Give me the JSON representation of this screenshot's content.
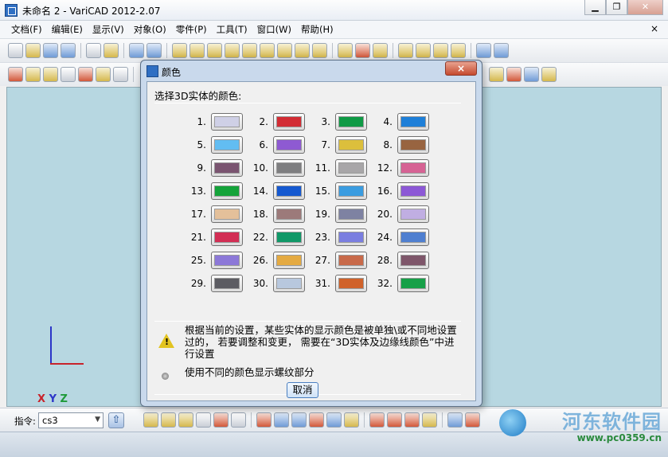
{
  "window": {
    "title": "未命名 2 - VariCAD 2012-2.07"
  },
  "menu": [
    "文档(F)",
    "编辑(E)",
    "显示(V)",
    "对象(O)",
    "零件(P)",
    "工具(T)",
    "窗口(W)",
    "帮助(H)"
  ],
  "menu_close": "×",
  "axes": {
    "x": "X",
    "y": "Y",
    "z": "Z"
  },
  "command": {
    "label": "指令:",
    "value": "cs3"
  },
  "dialog": {
    "title": "颜色",
    "close": "×",
    "heading": "选择3D实体的颜色:",
    "colors": [
      {
        "num": "1.",
        "color": "#cfd0e6"
      },
      {
        "num": "2.",
        "color": "#d22c34"
      },
      {
        "num": "3.",
        "color": "#0f9a45"
      },
      {
        "num": "4.",
        "color": "#1e7fd8"
      },
      {
        "num": "5.",
        "color": "#62bdf2"
      },
      {
        "num": "6.",
        "color": "#8e5ad2"
      },
      {
        "num": "7.",
        "color": "#dcbf3c"
      },
      {
        "num": "8.",
        "color": "#986440"
      },
      {
        "num": "9.",
        "color": "#7a5470"
      },
      {
        "num": "10.",
        "color": "#7e7e80"
      },
      {
        "num": "11.",
        "color": "#a8a6a8"
      },
      {
        "num": "12.",
        "color": "#d66394"
      },
      {
        "num": "13.",
        "color": "#14a33a"
      },
      {
        "num": "14.",
        "color": "#1559d0"
      },
      {
        "num": "15.",
        "color": "#3a9ce0"
      },
      {
        "num": "16.",
        "color": "#8c58d6"
      },
      {
        "num": "17.",
        "color": "#e4c09a"
      },
      {
        "num": "18.",
        "color": "#9c7a7a"
      },
      {
        "num": "19.",
        "color": "#7e82a2"
      },
      {
        "num": "20.",
        "color": "#c0aee2"
      },
      {
        "num": "21.",
        "color": "#d22e54"
      },
      {
        "num": "22.",
        "color": "#109868"
      },
      {
        "num": "23.",
        "color": "#7a7ee0"
      },
      {
        "num": "24.",
        "color": "#4f7fd0"
      },
      {
        "num": "25.",
        "color": "#8c78d8"
      },
      {
        "num": "26.",
        "color": "#e4aa42"
      },
      {
        "num": "27.",
        "color": "#c86a4a"
      },
      {
        "num": "28.",
        "color": "#7e566a"
      },
      {
        "num": "29.",
        "color": "#5c5c62"
      },
      {
        "num": "30.",
        "color": "#b8c8de"
      },
      {
        "num": "31.",
        "color": "#d0622a"
      },
      {
        "num": "32.",
        "color": "#17a048"
      }
    ],
    "warning_text": "根据当前的设置，某些实体的显示颜色是被单独\\或不同地设置过的，  若要调整和变更， 需要在“3D实体及边缘线颜色”中进行设置",
    "option_text": "使用不同的颜色显示螺纹部分",
    "cancel": "取消"
  },
  "watermark": {
    "title": "河东软件园",
    "url": "www.pc0359.cn"
  }
}
